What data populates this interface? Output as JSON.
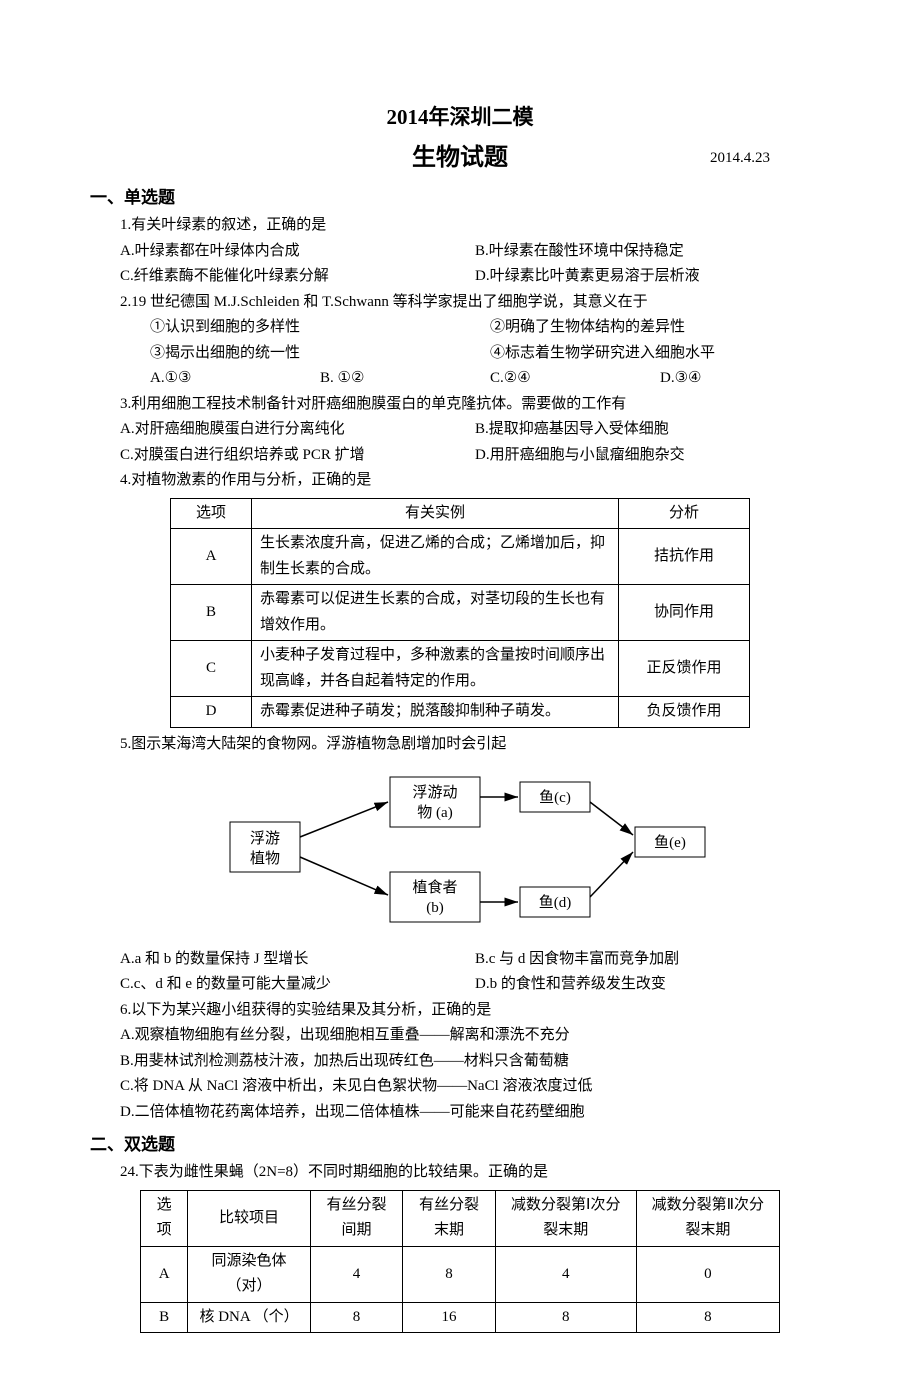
{
  "header": {
    "title": "2014年深圳二模",
    "subtitle": "生物试题",
    "date": "2014.4.23"
  },
  "section1": {
    "heading": "一、单选题",
    "q1": {
      "stem": "1.有关叶绿素的叙述，正确的是",
      "A": "A.叶绿素都在叶绿体内合成",
      "B": "B.叶绿素在酸性环境中保持稳定",
      "C": "C.纤维素酶不能催化叶绿素分解",
      "D": "D.叶绿素比叶黄素更易溶于层析液"
    },
    "q2": {
      "stem": "2.19 世纪德国 M.J.Schleiden 和 T.Schwann 等科学家提出了细胞学说，其意义在于",
      "o1": "①认识到细胞的多样性",
      "o2": "②明确了生物体结构的差异性",
      "o3": "③揭示出细胞的统一性",
      "o4": "④标志着生物学研究进入细胞水平",
      "A": "A.①③",
      "B": "B. ①②",
      "C": "C.②④",
      "D": "D.③④"
    },
    "q3": {
      "stem": "3.利用细胞工程技术制备针对肝癌细胞膜蛋白的单克隆抗体。需要做的工作有",
      "A": "A.对肝癌细胞膜蛋白进行分离纯化",
      "B": "B.提取抑癌基因导入受体细胞",
      "C": "C.对膜蛋白进行组织培养或 PCR 扩增",
      "D": "D.用肝癌细胞与小鼠瘤细胞杂交"
    },
    "q4": {
      "stem": "4.对植物激素的作用与分析，正确的是",
      "headers": {
        "c1": "选项",
        "c2": "有关实例",
        "c3": "分析"
      },
      "rows": [
        {
          "opt": "A",
          "example": "生长素浓度升高，促进乙烯的合成；乙烯增加后，抑制生长素的合成。",
          "analysis": "拮抗作用"
        },
        {
          "opt": "B",
          "example": "赤霉素可以促进生长素的合成，对茎切段的生长也有增效作用。",
          "analysis": "协同作用"
        },
        {
          "opt": "C",
          "example": "小麦种子发育过程中，多种激素的含量按时间顺序出现高峰，并各自起着特定的作用。",
          "analysis": "正反馈作用"
        },
        {
          "opt": "D",
          "example": "赤霉素促进种子萌发；脱落酸抑制种子萌发。",
          "analysis": "负反馈作用"
        }
      ]
    },
    "q5": {
      "stem": "5.图示某海湾大陆架的食物网。浮游植物急剧增加时会引起",
      "diagram": {
        "node1": "浮游\n植物",
        "node2": "浮游动\n物 (a)",
        "node3": "植食者\n(b)",
        "node4": "鱼(c)",
        "node5": "鱼(d)",
        "node6": "鱼(e)"
      },
      "A": "A.a 和 b 的数量保持 J 型增长",
      "B": "B.c 与 d 因食物丰富而竞争加剧",
      "C": "C.c、d 和 e 的数量可能大量减少",
      "D": "D.b 的食性和营养级发生改变"
    },
    "q6": {
      "stem": "6.以下为某兴趣小组获得的实验结果及其分析，正确的是",
      "A": "A.观察植物细胞有丝分裂，出现细胞相互重叠——解离和漂洗不充分",
      "B": "B.用斐林试剂检测荔枝汁液，加热后出现砖红色——材料只含葡萄糖",
      "C": "C.将 DNA 从 NaCl 溶液中析出，未见白色絮状物——NaCl 溶液浓度过低",
      "D": "D.二倍体植物花药离体培养，出现二倍体植株——可能来自花药壁细胞"
    }
  },
  "section2": {
    "heading": "二、双选题",
    "q24": {
      "stem": "24.下表为雌性果蝇（2N=8）不同时期细胞的比较结果。正确的是",
      "headers": {
        "c1": "选项",
        "c2": "比较项目",
        "c3": "有丝分裂间期",
        "c4": "有丝分裂末期",
        "c5": "减数分裂第Ⅰ次分裂末期",
        "c6": "减数分裂第Ⅱ次分裂末期"
      },
      "rows": [
        {
          "opt": "A",
          "item": "同源染色体（对）",
          "v1": "4",
          "v2": "8",
          "v3": "4",
          "v4": "0"
        },
        {
          "opt": "B",
          "item": "核 DNA （个）",
          "v1": "8",
          "v2": "16",
          "v3": "8",
          "v4": "8"
        }
      ]
    }
  }
}
